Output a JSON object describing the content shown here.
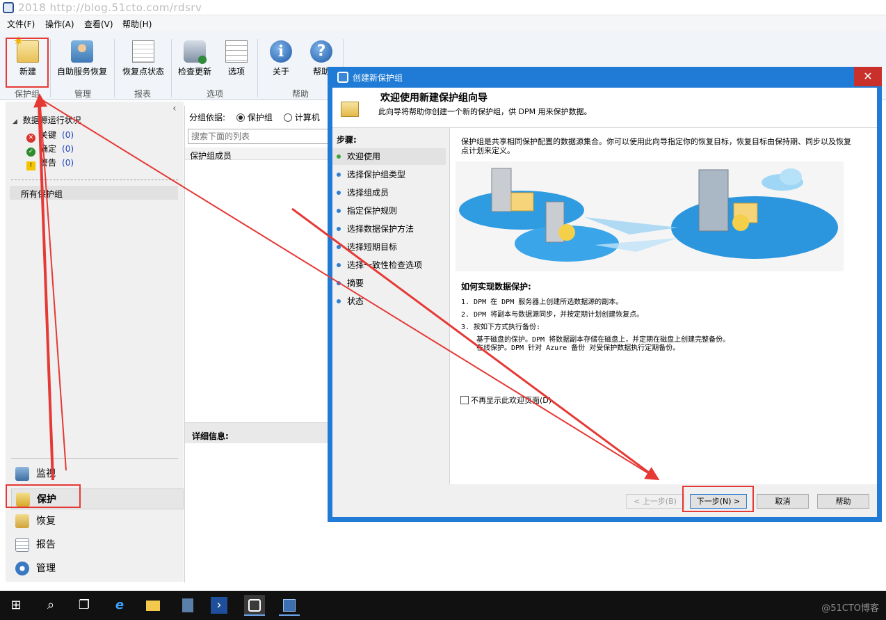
{
  "window": {
    "watermark": "2018 http://blog.51cto.com/rdsrv"
  },
  "menu": [
    "文件(F)",
    "操作(A)",
    "查看(V)",
    "帮助(H)"
  ],
  "ribbon": {
    "buttons": {
      "new": "新建",
      "self_service": "自助服务恢复",
      "recovery_point_status": "恢复点状态",
      "check_update": "检查更新",
      "options": "选项",
      "about": "关于",
      "help": "帮助"
    },
    "groups": {
      "protection_group": "保护组",
      "manage": "管理",
      "report": "报表",
      "options": "选项",
      "help": "帮助"
    },
    "icons": {
      "info": "i",
      "help": "?"
    }
  },
  "sidebar": {
    "collapse_glyph": "‹",
    "health_title": "数据源运行状况",
    "health": [
      {
        "label": "关键",
        "count": "(0)",
        "icon": "error-icon"
      },
      {
        "label": "确定",
        "count": "(0)",
        "icon": "ok-icon"
      },
      {
        "label": "警告",
        "count": "(0)",
        "icon": "warning-icon"
      }
    ],
    "all_groups": "所有保护组",
    "nav": [
      "监视",
      "保护",
      "恢复",
      "报告",
      "管理"
    ]
  },
  "middle": {
    "group_by_label": "分组依据:",
    "group_by_options": [
      "保护组",
      "计算机"
    ],
    "search_placeholder": "搜索下面的列表",
    "column_header": "保护组成员",
    "details_label": "详细信息:"
  },
  "dialog": {
    "title": "创建新保护组",
    "close_glyph": "✕",
    "header_title": "欢迎使用新建保护组向导",
    "header_subtitle": "此向导将帮助你创建一个新的保护组，供 DPM 用来保护数据。",
    "steps_title": "步骤:",
    "steps": [
      "欢迎使用",
      "选择保护组类型",
      "选择组成员",
      "指定保护规则",
      "选择数据保护方法",
      "选择短期目标",
      "选择一致性检查选项",
      "摘要",
      "状态"
    ],
    "intro": "保护组是共享相同保护配置的数据源集合。你可以使用此向导指定你的恢复目标，恢复目标由保持期、同步以及恢复点计划来定义。",
    "how_title": "如何实现数据保护:",
    "how_items": [
      "1. DPM 在 DPM 服务器上创建所选数据源的副本。",
      "2. DPM 将副本与数据源同步，并按定期计划创建恢复点。",
      "3. 按如下方式执行备份:"
    ],
    "sub_items": [
      "基于磁盘的保护。DPM 将数据副本存储在磁盘上，并定期在磁盘上创建完整备份。",
      "在线保护。DPM 针对 Azure 备份 对受保护数据执行定期备份。"
    ],
    "dont_show": "不再显示此欢迎页面(D)",
    "buttons": {
      "back": "< 上一步(B)",
      "next": "下一步(N) >",
      "cancel": "取消",
      "help": "帮助"
    }
  },
  "taskbar": {
    "icons": [
      "windows-start-icon",
      "search-icon",
      "task-view-icon",
      "ie-icon",
      "explorer-icon",
      "server-manager-icon",
      "powershell-icon",
      "dpm-console-icon",
      "dpm-console2-icon"
    ],
    "glyphs": {
      "start": "⊞",
      "search": "⌕",
      "task_view": "❐",
      "ie": "e",
      "powershell": "›"
    },
    "watermark": "@51CTO博客"
  },
  "colors": {
    "dialog_border": "#1f7bd6",
    "highlight": "#e53935"
  }
}
